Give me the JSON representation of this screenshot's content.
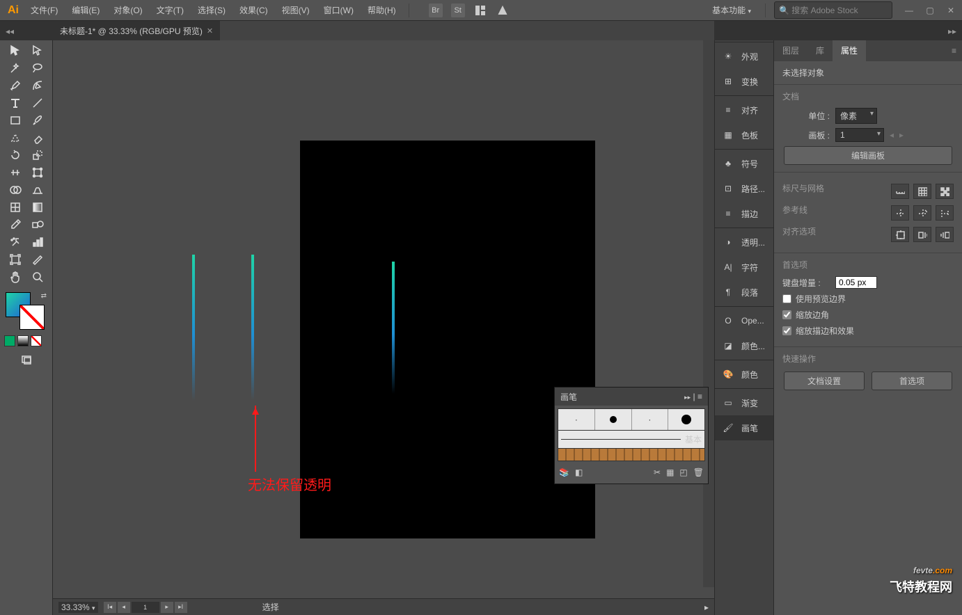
{
  "menu": [
    "文件(F)",
    "编辑(E)",
    "对象(O)",
    "文字(T)",
    "选择(S)",
    "效果(C)",
    "视图(V)",
    "窗口(W)",
    "帮助(H)"
  ],
  "topIcons": {
    "br": "Br",
    "st": "St"
  },
  "workspace": "基本功能",
  "search_placeholder": "搜索 Adobe Stock",
  "docTab": "未标题-1* @ 33.33% (RGB/GPU 预览)",
  "annotation": "无法保留透明",
  "brushPanel": {
    "title": "画笔",
    "basic": "基本"
  },
  "iconPanel": [
    "外观",
    "变换",
    "对齐",
    "色板",
    "符号",
    "路径...",
    "描边",
    "透明...",
    "字符",
    "段落",
    "Ope...",
    "颜色...",
    "颜色",
    "渐变",
    "画笔"
  ],
  "propTabs": {
    "layers": "图层",
    "lib": "库",
    "props": "属性"
  },
  "props": {
    "noSel": "未选择对象",
    "doc": "文档",
    "unitLbl": "单位 :",
    "unitVal": "像素",
    "artLbl": "画板 :",
    "artVal": "1",
    "editArt": "编辑画板",
    "ruler": "标尺与网格",
    "guides": "参考线",
    "alignOpts": "对齐选项",
    "prefs": "首选项",
    "keyInc": "键盘增量 :",
    "keyVal": "0.05 px",
    "preview": "使用预览边界",
    "scaleCorner": "缩放边角",
    "scaleStroke": "缩放描边和效果",
    "quick": "快速操作",
    "docSet": "文档设置",
    "prefBtn": "首选项"
  },
  "status": {
    "zoom": "33.33%",
    "page": "1",
    "cmd": "选择"
  },
  "watermark": {
    "l1a": "fevte",
    "l1b": ".com",
    "l2": "飞特教程网"
  }
}
